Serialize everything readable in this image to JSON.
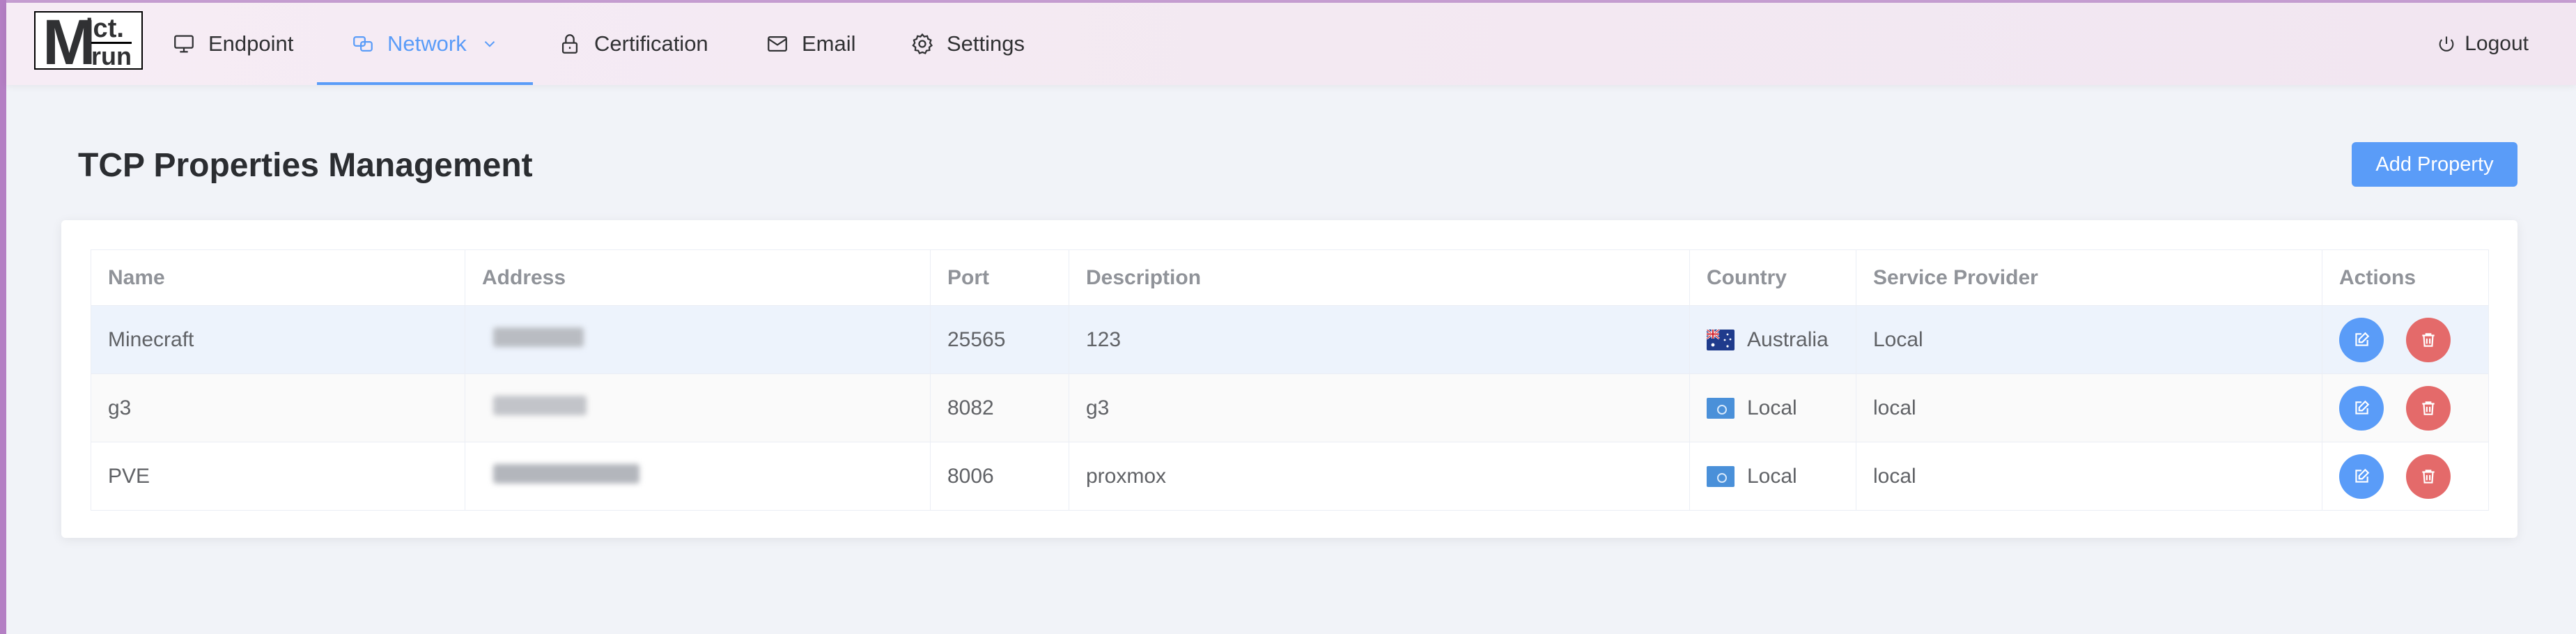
{
  "nav": {
    "logo": {
      "line1": "M",
      "line2": "ict.",
      "line3": "run"
    },
    "items": [
      {
        "label": "Endpoint",
        "icon": "monitor-icon"
      },
      {
        "label": "Network",
        "icon": "network-icon",
        "active": true
      },
      {
        "label": "Certification",
        "icon": "lock-icon"
      },
      {
        "label": "Email",
        "icon": "mail-icon"
      },
      {
        "label": "Settings",
        "icon": "gear-icon"
      }
    ],
    "logout": "Logout"
  },
  "page": {
    "title": "TCP Properties Management",
    "add_button": "Add Property"
  },
  "table": {
    "columns": [
      "Name",
      "Address",
      "Port",
      "Description",
      "Country",
      "Service Provider",
      "Actions"
    ],
    "rows": [
      {
        "name": "Minecraft",
        "port": "25565",
        "description": "123",
        "country": "Australia",
        "flag": "australia-flag-icon",
        "provider": "Local"
      },
      {
        "name": "g3",
        "port": "8082",
        "description": "g3",
        "country": "Local",
        "flag": "un-flag-icon",
        "provider": "local"
      },
      {
        "name": "PVE",
        "port": "8006",
        "description": "proxmox",
        "country": "Local",
        "flag": "un-flag-icon",
        "provider": "local"
      }
    ]
  },
  "colors": {
    "accent": "#5a9cf8",
    "danger": "#e46a6a",
    "selected_row": "#edf3fc"
  }
}
